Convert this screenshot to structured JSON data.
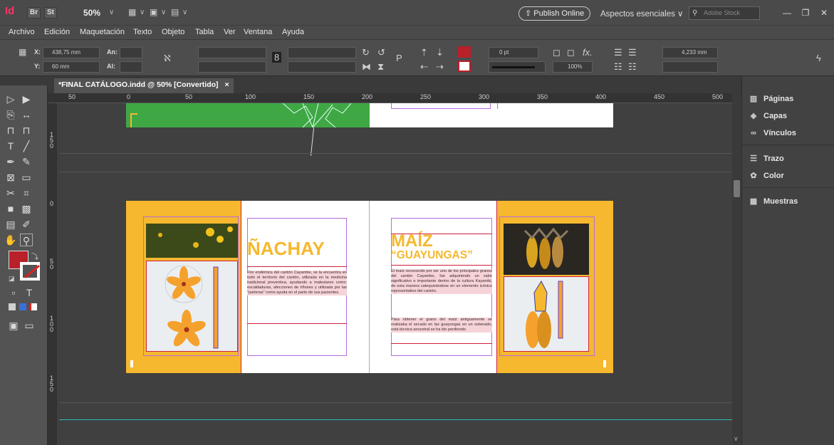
{
  "appbar": {
    "app_logo": "Id",
    "bridge": "Br",
    "stock_btn": "St",
    "zoom": "50%",
    "publish": "Publish Online",
    "workspace": "Aspectos esenciales",
    "search_placeholder": "Adobe Stock"
  },
  "menu": [
    "Archivo",
    "Edición",
    "Maquetación",
    "Texto",
    "Objeto",
    "Tabla",
    "Ver",
    "Ventana",
    "Ayuda"
  ],
  "control": {
    "x_label": "X:",
    "x_value": "438,75 mm",
    "y_label": "Y:",
    "y_value": "60 mm",
    "w_label": "An:",
    "h_label": "Al:",
    "stroke_weight": "0 pt",
    "opacity": "100%",
    "gap": "4,233 mm",
    "fx": "fx."
  },
  "tab": {
    "title": "*FINAL CATÁLOGO.indd @ 50% [Convertido]",
    "close": "×"
  },
  "ruler": {
    "h_ticks": [
      "50",
      "0",
      "50",
      "100",
      "150",
      "200",
      "250",
      "300",
      "350",
      "400",
      "450",
      "500"
    ],
    "v_ticks": [
      "1\n5\n0",
      "0",
      "5\n0",
      "1\n0\n0",
      "1\n5\n0"
    ]
  },
  "panels": [
    "Páginas",
    "Capas",
    "Vínculos",
    "Trazo",
    "Color",
    "Muestras"
  ],
  "spread": {
    "left_title": "ÑACHAY",
    "left_body": "Flor endémica del cantón Cayambe, se la encuentra en todo el territorio del cantón, utilizada en la medicina tradicional preventiva, ayudando a malestares como: escaldaduras, afecciones de riñones y utilizada por las \"parteras\" como ayuda en el parto de sus pacientes.",
    "right_title_1": "MAÍZ",
    "right_title_2": "“GUAYUNGAS”",
    "right_body_1": "El maíz reconocido por ser uno de los principales granos del cantón Cayambe, fue adquiriendo un valor significativo e importante dentro de la cultura Kayambi, de esta manera catequizándose en un elemento icónico representativo del cantón.",
    "right_body_2": "Para obtener el grano del maíz antiguamente se realizaba el secado en las guayungas en un soberado, esta técnica ancestral se ha ido perdiendo."
  },
  "colors": {
    "accent_orange": "#f5b82e",
    "fill_red": "#b8202a",
    "green": "#3fa845"
  }
}
